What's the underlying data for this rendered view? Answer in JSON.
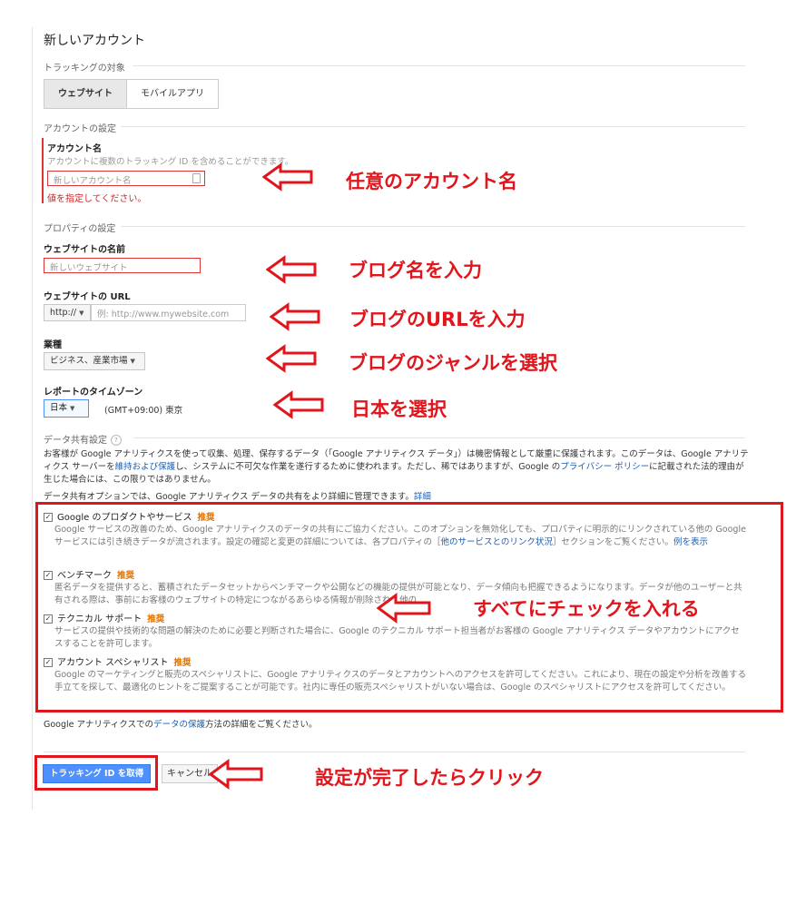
{
  "page": {
    "title": "新しいアカウント",
    "tracking_target_label": "トラッキングの対象",
    "tabs": [
      "ウェブサイト",
      "モバイルアプリ"
    ]
  },
  "account_settings": {
    "section_label": "アカウントの設定",
    "name_label": "アカウント名",
    "name_help": "アカウントに複数のトラッキング ID を含めることができます。",
    "name_placeholder": "新しいアカウント名",
    "name_error": "値を指定してください。"
  },
  "property_settings": {
    "section_label": "プロパティの設定",
    "site_name_label": "ウェブサイトの名前",
    "site_name_placeholder": "新しいウェブサイト",
    "site_url_label": "ウェブサイトの URL",
    "protocol": "http://",
    "url_placeholder": "例: http://www.mywebsite.com",
    "industry_label": "業種",
    "industry_value": "ビジネス、産業市場",
    "timezone_label": "レポートのタイムゾーン",
    "timezone_country": "日本",
    "timezone_value": "(GMT+09:00) 東京"
  },
  "data_sharing": {
    "section_label": "データ共有設定",
    "info_icon": "?",
    "para1_pre": "お客様が Google アナリティクスを使って収集、処理、保存するデータ（「Google アナリティクス データ」）は機密情報として厳重に保護されます。このデータは、Google アナリティクス サーバーを",
    "para1_link1": "維持および保護",
    "para1_mid": "し、システムに不可欠な作業を遂行するために使われます。ただし、稀ではありますが、Google の",
    "para1_link2": "プライバシー ポリシー",
    "para1_post": "に記載された法的理由が生じた場合には、この限りではありません。",
    "para2_pre": "データ共有オプションでは、Google アナリティクス データの共有をより詳細に管理できます。",
    "para2_link": "詳細",
    "recommended": "推奨",
    "options": [
      {
        "title": "Google のプロダクトやサービス",
        "desc_pre": "Google サービスの改善のため、Google アナリティクスのデータの共有にご協力ください。このオプションを無効化しても、プロパティに明示的にリンクされている他の Google サービスには引き続きデータが流されます。設定の確認と変更の詳細については、各プロパティの［",
        "desc_link1": "他のサービスとのリンク状況",
        "desc_mid": "］セクションをご覧ください。",
        "desc_link2": "例を表示"
      },
      {
        "title": "ベンチマーク",
        "desc": "匿名データを提供すると、蓄積されたデータセットからベンチマークや公開などの機能の提供が可能となり、データ傾向も把握できるようになります。データが他のユーザーと共有される際は、事前にお客様のウェブサイトの特定につながるあらゆる情報が削除され、他の"
      },
      {
        "title": "テクニカル サポート",
        "desc": "サービスの提供や技術的な問題の解決のために必要と判断された場合に、Google のテクニカル サポート担当者がお客様の Google アナリティクス データやアカウントにアクセスすることを許可します。"
      },
      {
        "title": "アカウント スペシャリスト",
        "desc": "Google のマーケティングと販売のスペシャリストに、Google アナリティクスのデータとアカウントへのアクセスを許可してください。これにより、現在の設定や分析を改善する手立てを探して、最適化のヒントをご提案することが可能です。社内に専任の販売スペシャリストがいない場合は、Google のスペシャリストにアクセスを許可してください。"
      }
    ],
    "footer_pre": "Google アナリティクスでの",
    "footer_link": "データの保護",
    "footer_post": "方法の詳細をご覧ください。"
  },
  "buttons": {
    "get_tracking_id": "トラッキング ID を取得",
    "cancel": "キャンセル"
  },
  "annotations": {
    "account_name": "任意のアカウント名",
    "blog_name": "ブログ名を入力",
    "blog_url": "ブログのURLを入力",
    "blog_genre": "ブログのジャンルを選択",
    "japan": "日本を選択",
    "check_all": "すべてにチェックを入れる",
    "click_done": "設定が完了したらクリック"
  },
  "icons": {
    "checkbox_checked": "✓",
    "arrow": "left-arrow-icon"
  },
  "colors": {
    "annotation_red": "#e0161c",
    "primary_blue": "#4d90fe",
    "recommended_orange": "#e37400",
    "link_blue": "#1a5fb4"
  }
}
